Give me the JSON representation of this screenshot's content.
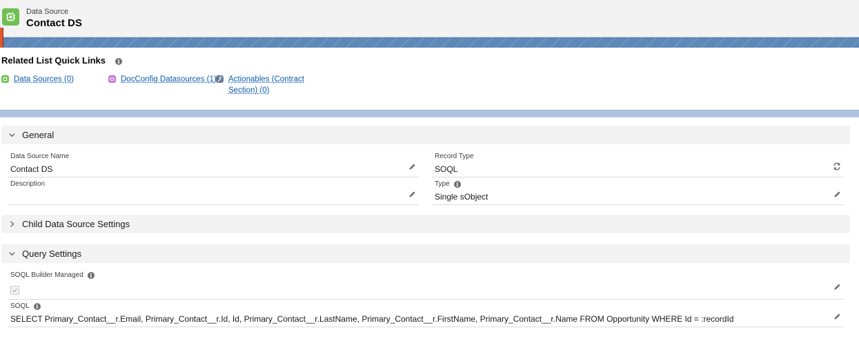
{
  "header": {
    "subtitle": "Data Source",
    "title": "Contact DS",
    "icon": "datasource-icon",
    "icon_color": "#6fc053"
  },
  "related_list": {
    "title": "Related List Quick Links",
    "links": [
      {
        "label": "Data Sources (0)",
        "icon": "datasource-icon",
        "color": "#6fc053"
      },
      {
        "label": "DocConfig Datasources (1)",
        "icon": "doc-config-icon",
        "color": "#c777d8"
      },
      {
        "label_line1": "Actionables (Contract",
        "label_line2": "Section) (0)",
        "icon": "wrench-icon",
        "color": "#6b7a99"
      }
    ]
  },
  "sections": {
    "general": "General",
    "child": "Child Data Source Settings",
    "query": "Query Settings"
  },
  "fields": {
    "ds_name": {
      "label": "Data Source Name",
      "value": "Contact DS"
    },
    "record_type": {
      "label": "Record Type",
      "value": "SOQL"
    },
    "description": {
      "label": "Description",
      "value": ""
    },
    "type": {
      "label": "Type",
      "value": "Single sObject"
    },
    "builder_managed": {
      "label": "SOQL Builder Managed",
      "checked": true
    },
    "soql": {
      "label": "SOQL",
      "value": "SELECT Primary_Contact__r.Email, Primary_Contact__r.Id, Id, Primary_Contact__r.LastName, Primary_Contact__r.FirstName, Primary_Contact__r.Name FROM Opportunity WHERE Id = :recordId"
    }
  },
  "colors": {
    "link": "#0b5cab",
    "banner": "#5d88b8",
    "section_bg": "#f3f3f3"
  }
}
